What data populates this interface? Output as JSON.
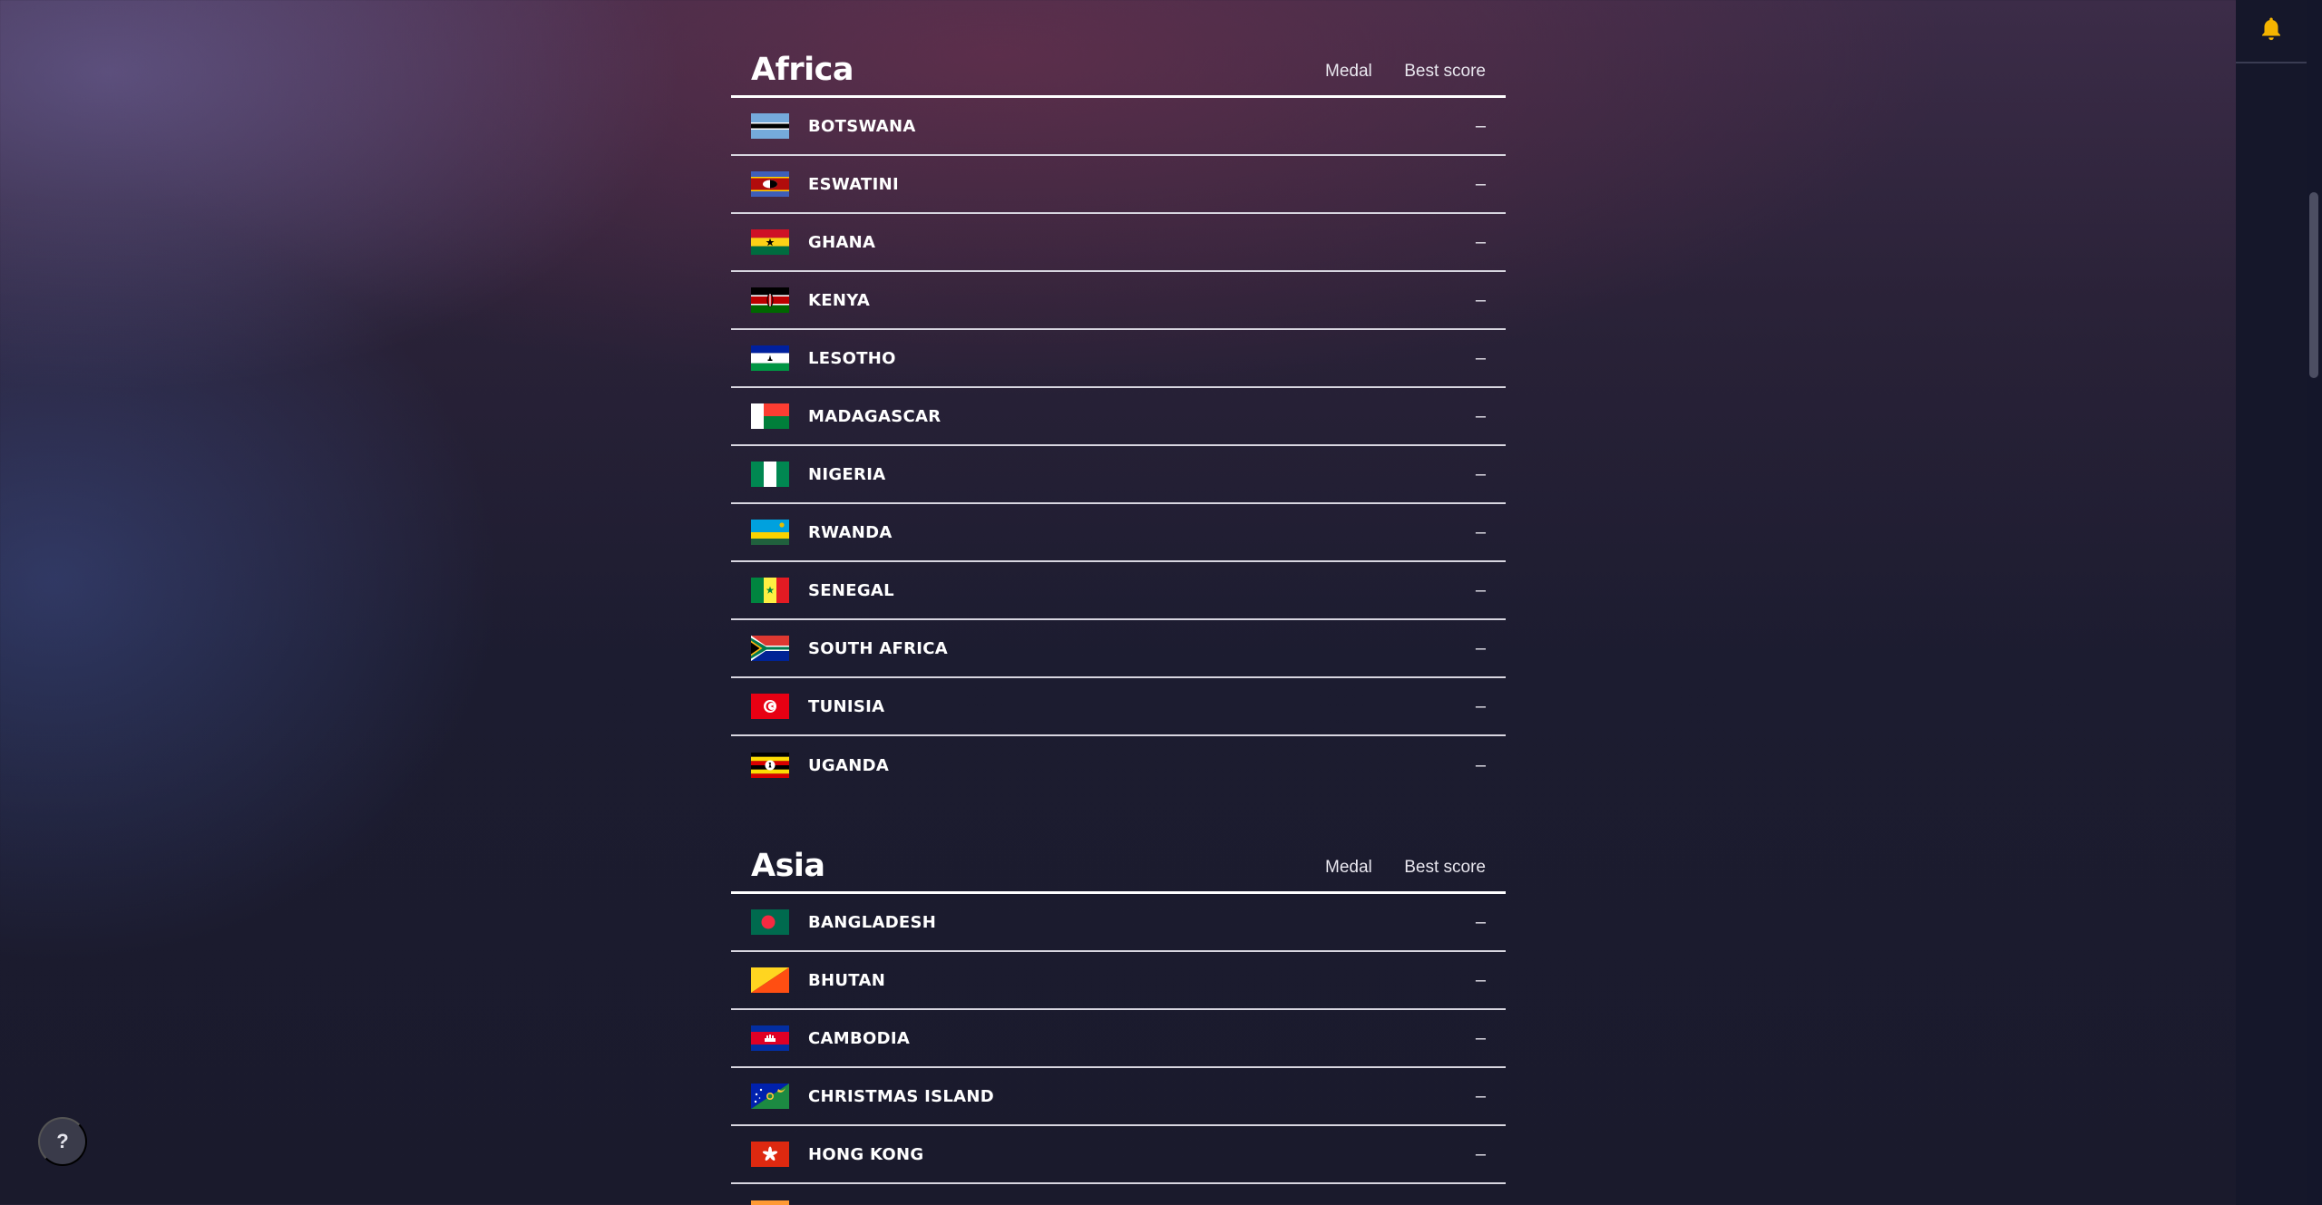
{
  "columns": {
    "medal": "Medal",
    "best_score": "Best score"
  },
  "regions": [
    {
      "title": "Africa",
      "countries": [
        {
          "name": "BOTSWANA",
          "score": "–",
          "flag": "botswana"
        },
        {
          "name": "ESWATINI",
          "score": "–",
          "flag": "eswatini"
        },
        {
          "name": "GHANA",
          "score": "–",
          "flag": "ghana"
        },
        {
          "name": "KENYA",
          "score": "–",
          "flag": "kenya"
        },
        {
          "name": "LESOTHO",
          "score": "–",
          "flag": "lesotho"
        },
        {
          "name": "MADAGASCAR",
          "score": "–",
          "flag": "madagascar"
        },
        {
          "name": "NIGERIA",
          "score": "–",
          "flag": "nigeria"
        },
        {
          "name": "RWANDA",
          "score": "–",
          "flag": "rwanda"
        },
        {
          "name": "SENEGAL",
          "score": "–",
          "flag": "senegal"
        },
        {
          "name": "SOUTH AFRICA",
          "score": "–",
          "flag": "south-africa"
        },
        {
          "name": "TUNISIA",
          "score": "–",
          "flag": "tunisia"
        },
        {
          "name": "UGANDA",
          "score": "–",
          "flag": "uganda"
        }
      ]
    },
    {
      "title": "Asia",
      "countries": [
        {
          "name": "BANGLADESH",
          "score": "–",
          "flag": "bangladesh"
        },
        {
          "name": "BHUTAN",
          "score": "–",
          "flag": "bhutan"
        },
        {
          "name": "CAMBODIA",
          "score": "–",
          "flag": "cambodia"
        },
        {
          "name": "CHRISTMAS ISLAND",
          "score": "–",
          "flag": "christmas-island"
        },
        {
          "name": "HONG KONG",
          "score": "–",
          "flag": "hong-kong"
        }
      ]
    }
  ],
  "help_button": {
    "label": "?"
  },
  "notification_icon": "bell-icon",
  "colors": {
    "bell": "#f5b400",
    "divider": "#ffffff",
    "rail": "#15172a"
  }
}
